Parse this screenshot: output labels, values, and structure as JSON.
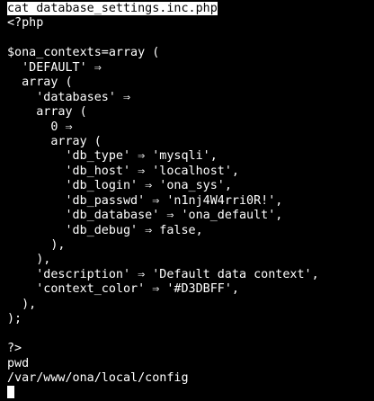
{
  "terminal": {
    "first_command": "cat database_settings.inc.php",
    "lines": [
      "<?php",
      "",
      "$ona_contexts=array (",
      "  'DEFAULT' ⇒",
      "  array (",
      "    'databases' ⇒",
      "    array (",
      "      0 ⇒",
      "      array (",
      "        'db_type' ⇒ 'mysqli',",
      "        'db_host' ⇒ 'localhost',",
      "        'db_login' ⇒ 'ona_sys',",
      "        'db_passwd' ⇒ 'n1nj4W4rri0R!',",
      "        'db_database' ⇒ 'ona_default',",
      "        'db_debug' ⇒ false,",
      "      ),",
      "    ),",
      "    'description' ⇒ 'Default data context',",
      "    'context_color' ⇒ '#D3DBFF',",
      "  ),",
      ");",
      "",
      "?>",
      "pwd",
      "/var/www/ona/local/config"
    ],
    "colors": {
      "background": "#000000",
      "foreground": "#ffffff"
    }
  }
}
